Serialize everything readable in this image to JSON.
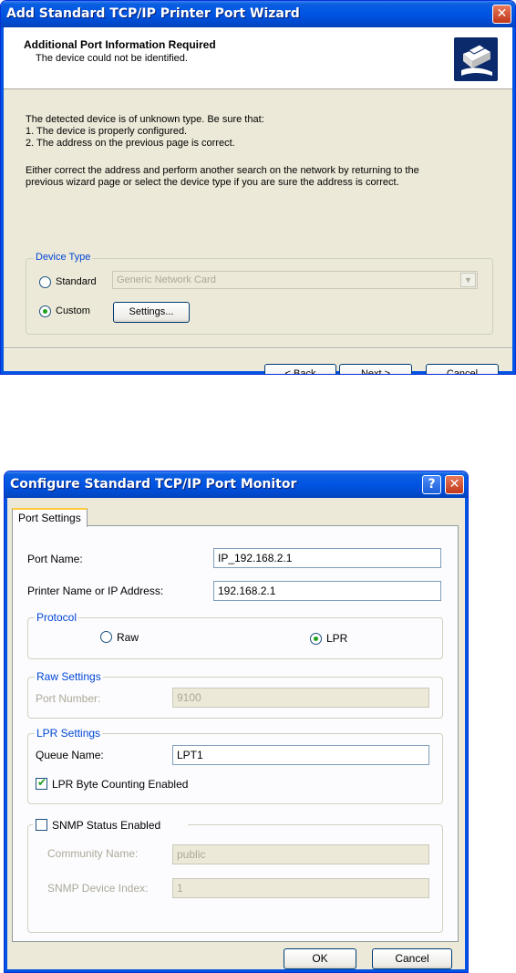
{
  "wizard": {
    "title": "Add Standard TCP/IP Printer Port Wizard",
    "header_title": "Additional Port Information Required",
    "header_subtitle": "The device could not be identified.",
    "body_lines": [
      "The detected device is of unknown type.  Be sure that:",
      "1. The device is properly configured.",
      "2.  The address on the previous page is correct."
    ],
    "body_paragraph_lines": [
      "Either correct the address and perform another search on the network by returning to the",
      "previous wizard page or select the device type if you are sure the address is correct."
    ],
    "device_type": {
      "label": "Device Type",
      "standard_label": "Standard",
      "standard_value": "Generic Network Card",
      "custom_label": "Custom",
      "settings_button": "Settings...",
      "selected": "Custom"
    },
    "buttons": {
      "back": "< Back",
      "next": "Next >",
      "cancel": "Cancel"
    }
  },
  "monitor": {
    "title": "Configure Standard TCP/IP Port Monitor",
    "tab": "Port Settings",
    "port_name_label": "Port Name:",
    "port_name_value": "IP_192.168.2.1",
    "printer_label": "Printer Name or IP Address:",
    "printer_value": "192.168.2.1",
    "protocol": {
      "label": "Protocol",
      "raw": "Raw",
      "lpr": "LPR",
      "selected": "LPR"
    },
    "raw_settings": {
      "label": "Raw Settings",
      "port_number_label": "Port Number:",
      "port_number_value": "9100"
    },
    "lpr_settings": {
      "label": "LPR Settings",
      "queue_label": "Queue Name:",
      "queue_value": "LPT1",
      "byte_counting_label": "LPR Byte Counting Enabled",
      "byte_counting_checked": true
    },
    "snmp": {
      "label": "SNMP Status Enabled",
      "checked": false,
      "community_label": "Community Name:",
      "community_value": "public",
      "index_label": "SNMP Device Index:",
      "index_value": "1"
    },
    "buttons": {
      "ok": "OK",
      "cancel": "Cancel"
    }
  },
  "colors": {
    "title_bar": "#0054e3",
    "dialog_bg": "#ece9d8",
    "group_label": "#0046d5",
    "radio_dot": "#21a121"
  }
}
